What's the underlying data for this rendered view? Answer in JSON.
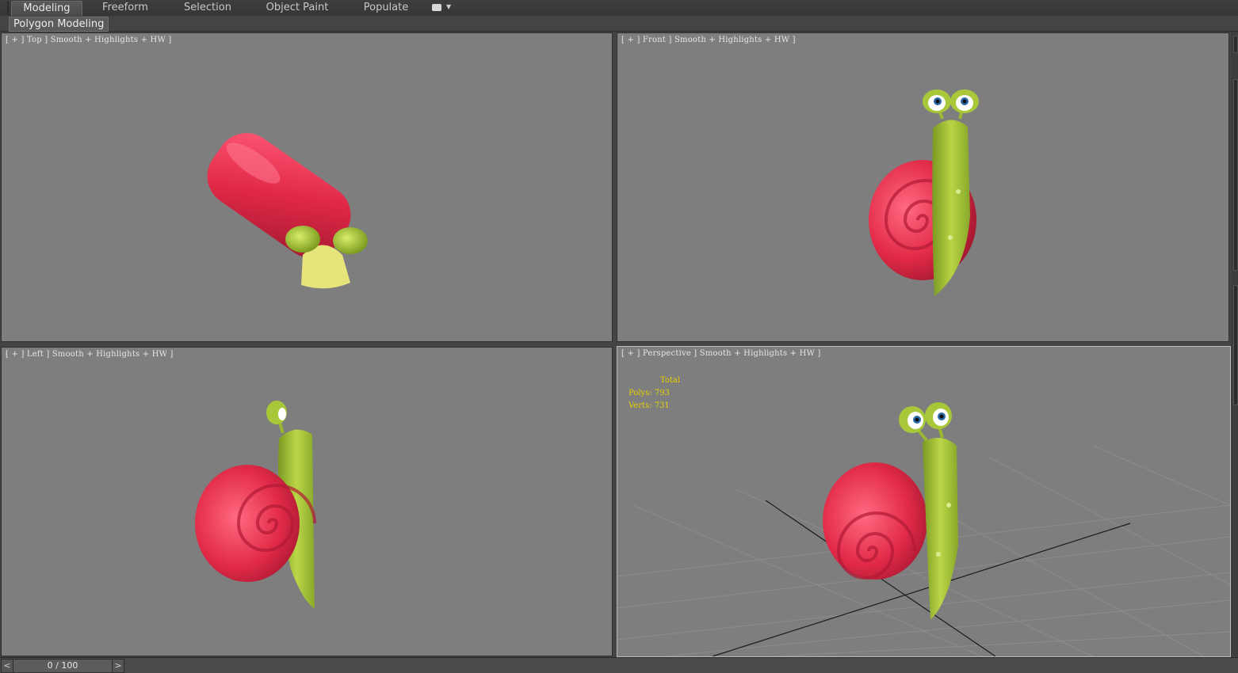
{
  "ribbon": {
    "tabs": [
      {
        "label": "Modeling",
        "active": true
      },
      {
        "label": "Freeform",
        "active": false
      },
      {
        "label": "Selection",
        "active": false
      },
      {
        "label": "Object Paint",
        "active": false
      },
      {
        "label": "Populate",
        "active": false
      }
    ],
    "options_icon": "ribbon-options-icon"
  },
  "panel": {
    "label": "Polygon Modeling"
  },
  "viewports": {
    "top": {
      "label": "[ + ] Top ] Smooth + Highlights + HW ]"
    },
    "front": {
      "label": "[ + ] Front ] Smooth + Highlights + HW ]"
    },
    "left": {
      "label": "[ + ] Left ] Smooth + Highlights + HW ]"
    },
    "perspective": {
      "label": "[ + ] Perspective ] Smooth + Highlights + HW ]",
      "stats": {
        "title": "Total",
        "polys": "Polys: 793",
        "verts": "Verts: 731"
      }
    }
  },
  "timeline": {
    "prev_label": "<",
    "next_label": ">",
    "frame_text": "0 / 100"
  },
  "colors": {
    "viewport_bg": "#7e7e7e",
    "shell_red": "#e8324e",
    "body_green": "#a8c83a",
    "stats_yellow": "#e8d200"
  }
}
